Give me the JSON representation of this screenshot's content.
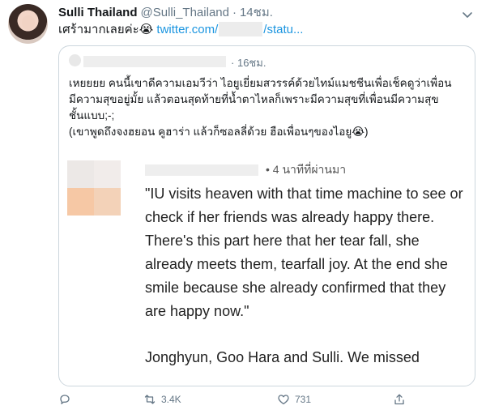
{
  "tweet": {
    "author_name": "Sulli Thailand",
    "author_handle": "@Sulli_Thailand",
    "separator": "·",
    "time": "14ชม.",
    "text_prefix": "เศร้ามากเลยค่ะ😭",
    "link_start": "twitter.com/",
    "link_end": "/statu..."
  },
  "quote": {
    "separator": "·",
    "time": "16ชม.",
    "lines": [
      "เหยยยย คนนี้เขาดีความเอมวีว่า ไอยูเยี่ยมสวรรค์ด้วยไทม์แมชชีนเพื่อเช็คดูว่าเพื่อน",
      "มีความสุขอยู่มั้ย แล้วตอนสุดท้ายที่น้ำตาไหลก็เพราะมีความสุขที่เพื่อนมีความสุข",
      "ชั้นแบบ;-;",
      "(เขาพูดถึงจงฮยอน คูฮาร่า แล้วก็ซอลลี่ด้วย ฮือเพื่อนๆของไอยู😭)"
    ]
  },
  "comment": {
    "time": "• 4 นาทีที่ผ่านมา",
    "paragraph1": "\"IU visits heaven with that time machine to see or check if her friends was already happy there. There's this part here that her tear fall, she already meets them, tearfall joy. At the end she smile because she already confirmed that they are happy now.\"",
    "paragraph2": "Jonghyun, Goo Hara and Sulli. We missed"
  },
  "actions": {
    "retweet_count": "3.4K",
    "like_count": "731"
  },
  "colors": {
    "link": "#1b95e0",
    "muted": "#657786",
    "border": "#ccd6dd"
  },
  "icons": [
    "chevron-down-icon",
    "reply-icon",
    "retweet-icon",
    "like-icon",
    "share-icon"
  ]
}
